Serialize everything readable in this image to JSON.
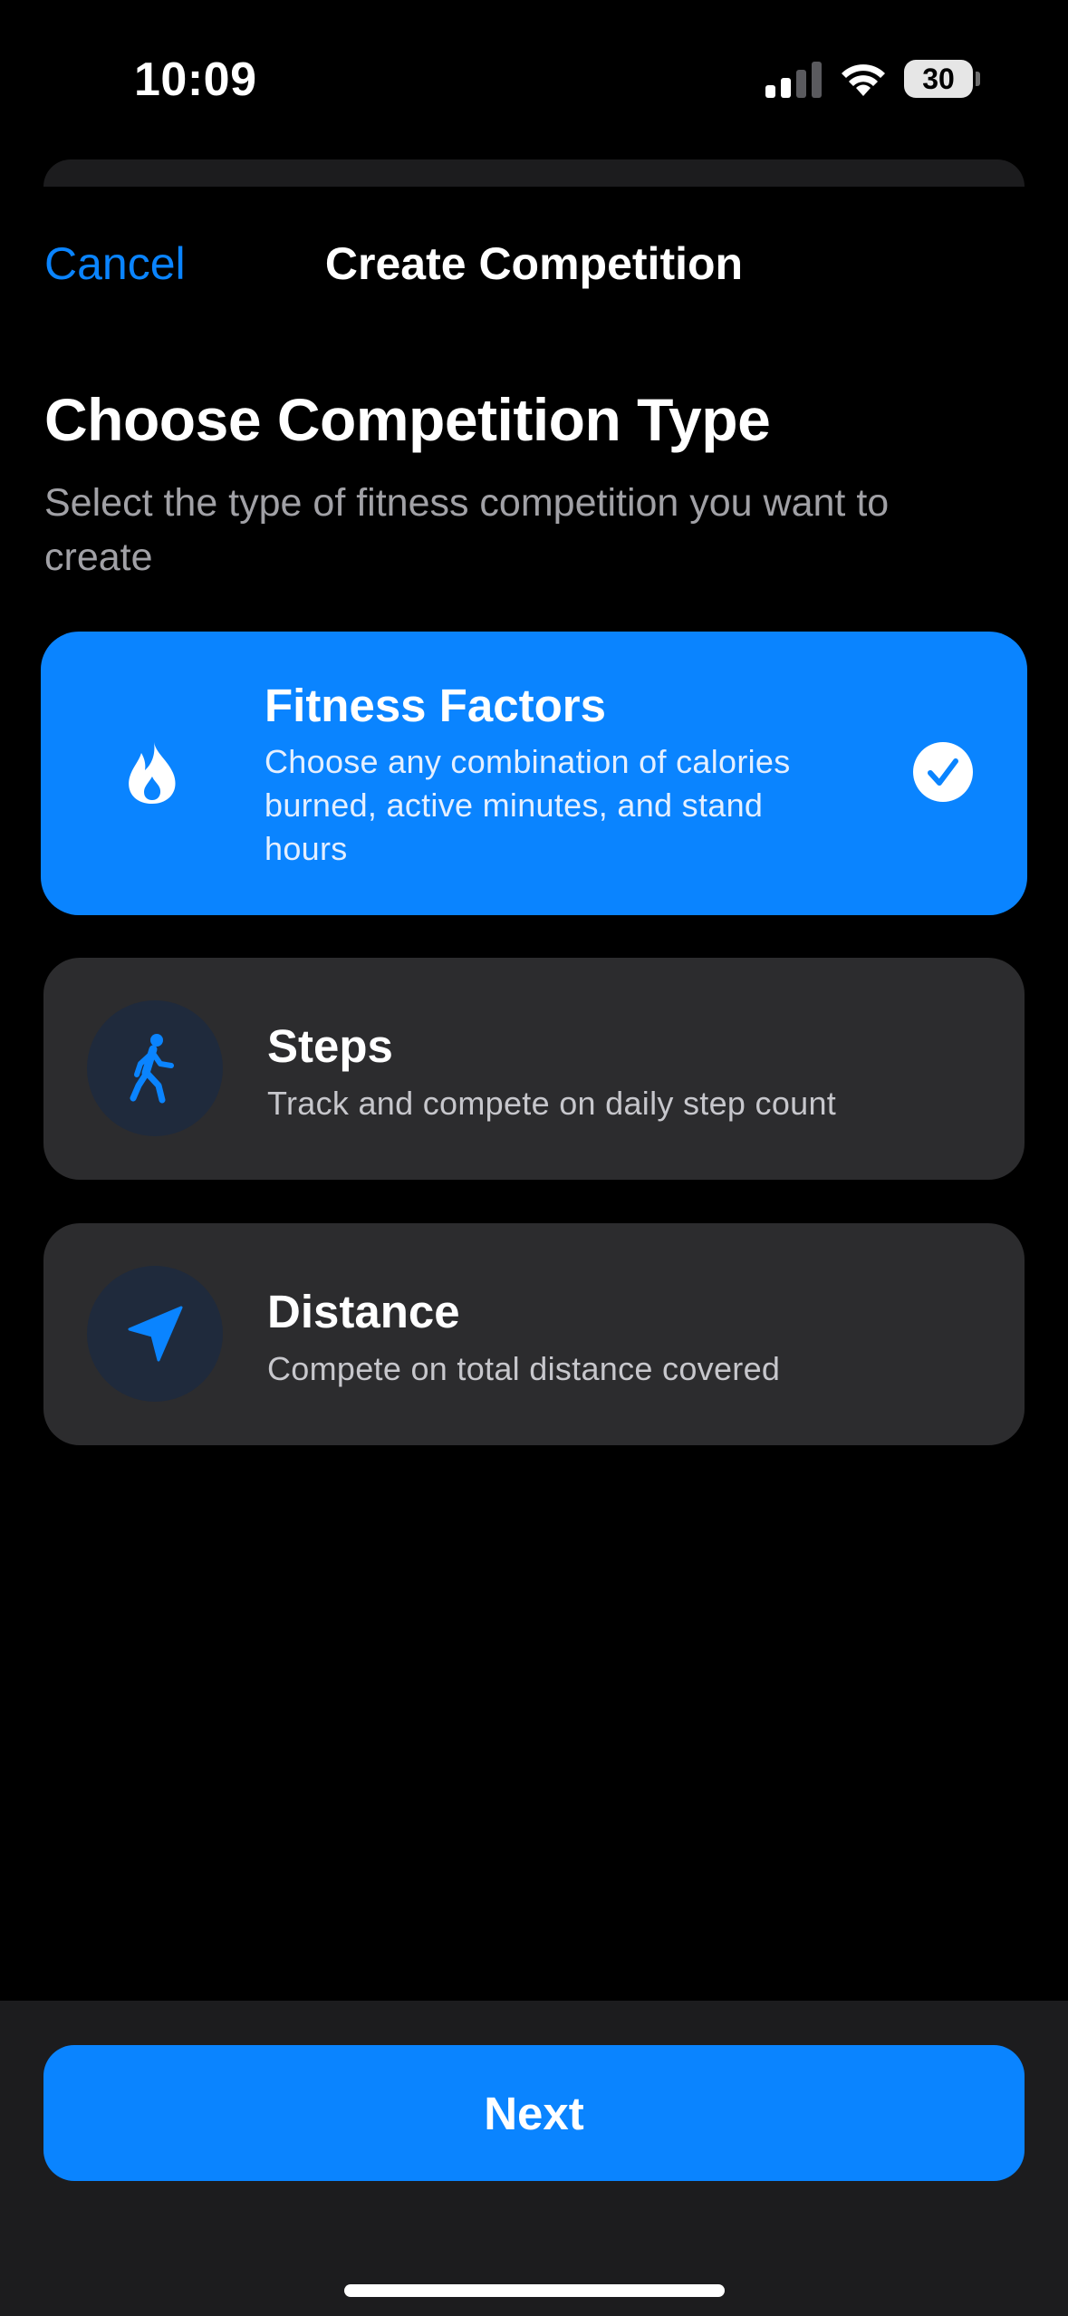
{
  "status_bar": {
    "time": "10:09",
    "battery": "30",
    "icons": [
      "signal-icon",
      "wifi-icon",
      "battery-icon"
    ]
  },
  "nav": {
    "cancel_label": "Cancel",
    "title": "Create Competition"
  },
  "header": {
    "title": "Choose Competition Type",
    "subtitle": "Select the type of fitness competition you want to create"
  },
  "options": [
    {
      "title": "Fitness Factors",
      "description": "Choose any combination of calories burned, active minutes, and stand hours",
      "icon": "flame-icon",
      "selected": true
    },
    {
      "title": "Steps",
      "description": "Track and compete on daily step count",
      "icon": "walking-figure-icon",
      "selected": false
    },
    {
      "title": "Distance",
      "description": "Compete on total distance covered",
      "icon": "location-arrow-icon",
      "selected": false
    }
  ],
  "footer": {
    "next_label": "Next"
  },
  "colors": {
    "accent": "#0a84ff",
    "background": "#000000",
    "card": "#2c2c2e",
    "secondary_text": "#a1a1a6"
  }
}
